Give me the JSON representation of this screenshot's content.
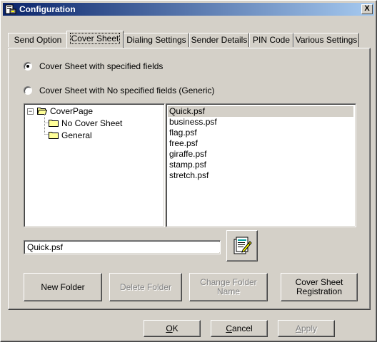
{
  "window": {
    "title": "Configuration",
    "close_label": "X"
  },
  "tabs": [
    {
      "label": "Send Option",
      "active": false
    },
    {
      "label": "Cover Sheet",
      "active": true
    },
    {
      "label": "Dialing Settings",
      "active": false
    },
    {
      "label": "Sender Details",
      "active": false
    },
    {
      "label": "PIN Code",
      "active": false
    },
    {
      "label": "Various Settings",
      "active": false
    }
  ],
  "cover_sheet": {
    "radio_specified": {
      "label": "Cover Sheet with specified fields",
      "checked": true
    },
    "radio_generic": {
      "label": "Cover Sheet with No specified fields (Generic)",
      "checked": false
    },
    "tree": {
      "root": {
        "label": "CoverPage",
        "expander": "−"
      },
      "children": [
        {
          "label": "No Cover Sheet"
        },
        {
          "label": "General"
        }
      ]
    },
    "files": [
      "Quick.psf",
      "business.psf",
      "flag.psf",
      "free.psf",
      "giraffe.psf",
      "stamp.psf",
      "stretch.psf"
    ],
    "selected_file": "Quick.psf",
    "filename_value": "Quick.psf",
    "buttons": {
      "new_folder": "New Folder",
      "delete_folder": "Delete Folder",
      "change_folder_name": "Change Folder Name",
      "cover_sheet_registration": "Cover Sheet Registration"
    }
  },
  "footer": {
    "ok": {
      "underline": "O",
      "rest": "K"
    },
    "cancel": {
      "underline": "C",
      "rest": "ancel"
    },
    "apply": {
      "underline": "A",
      "rest": "pply"
    }
  }
}
